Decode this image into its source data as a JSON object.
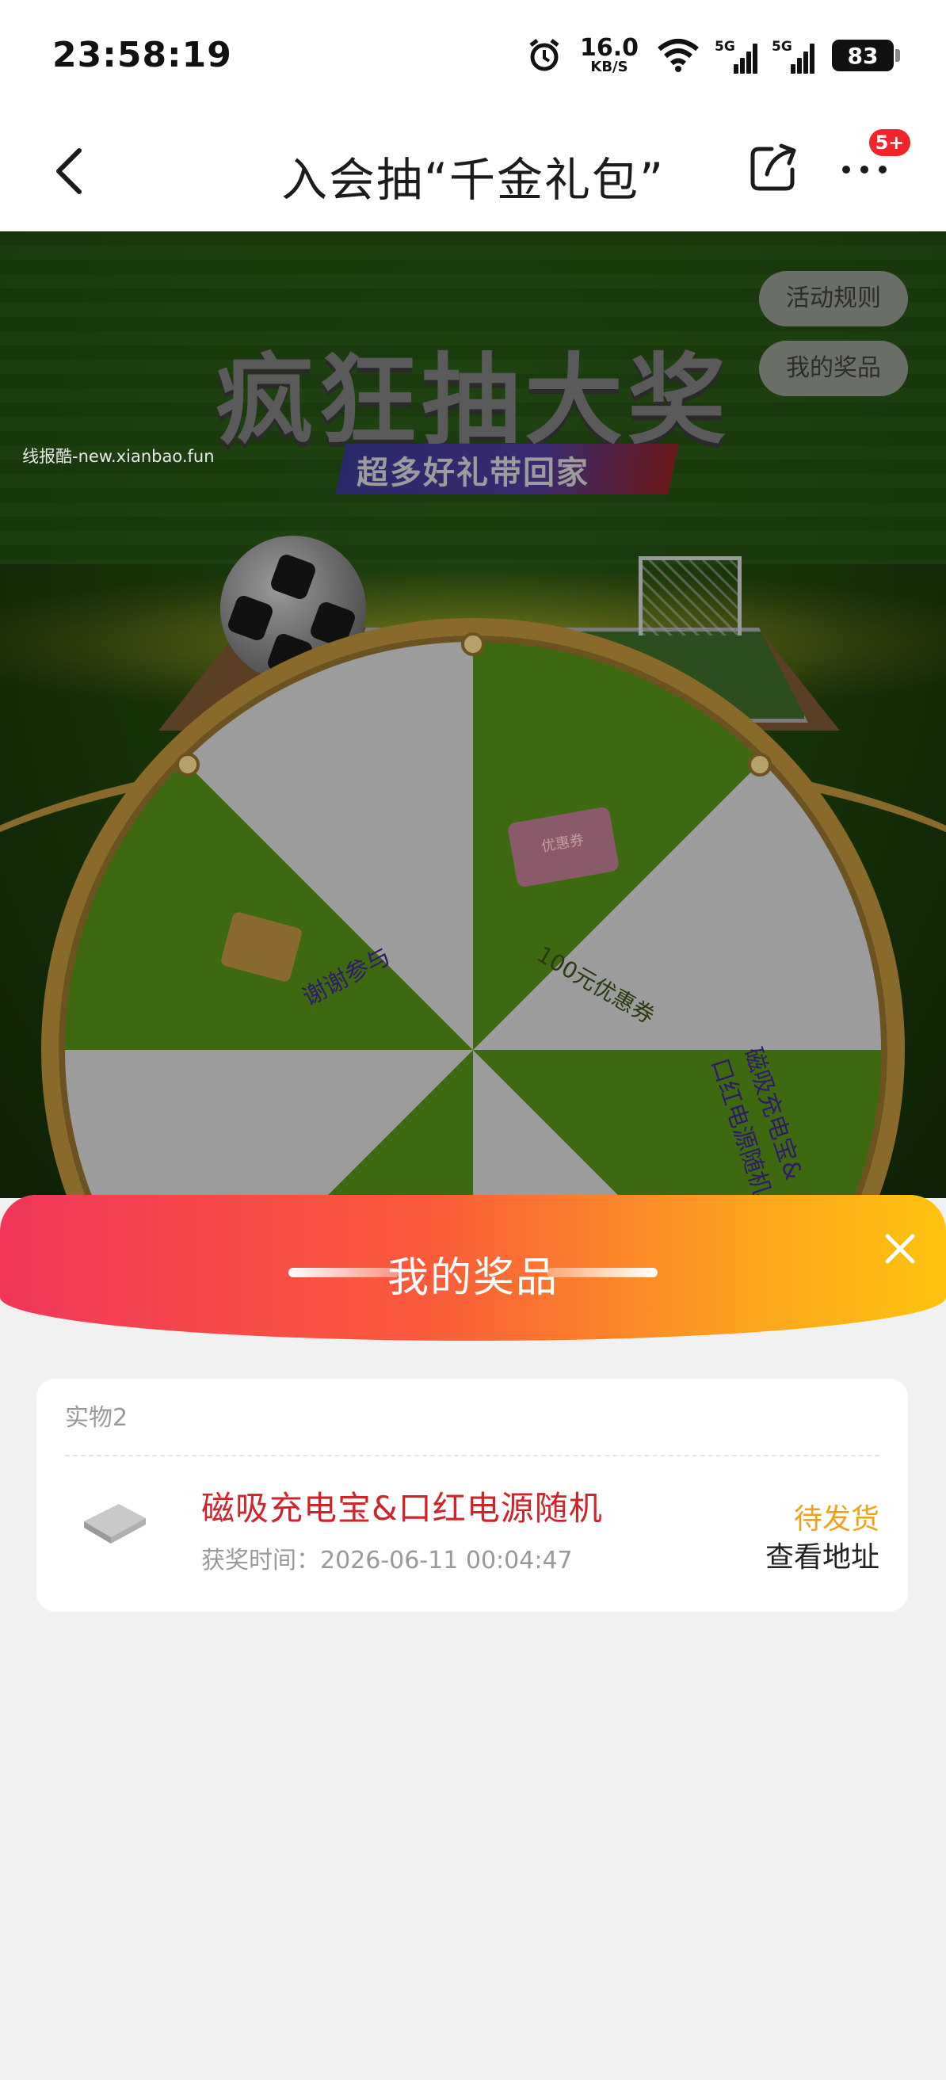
{
  "status_bar": {
    "time": "23:58:19",
    "net_speed": "16.0",
    "net_speed_unit": "KB/S",
    "signal1_label": "5G",
    "signal2_label": "5G",
    "battery": "83"
  },
  "nav": {
    "title": "入会抽“千金礼包”",
    "badge": "5+"
  },
  "activity": {
    "headline": "疯狂抽大奖",
    "subheadline": "超多好礼带回家",
    "rules_button": "活动规则",
    "my_prizes_button": "我的奖品",
    "watermark": "线报酷-new.xianbao.fun",
    "wheel": {
      "segments": [
        "谢谢参与",
        "100元优惠券",
        "磁吸充电宝&口红电源随机"
      ],
      "coupon_label": "优惠券"
    }
  },
  "sheet": {
    "title": "我的奖品",
    "section_label": "实物2",
    "prize": {
      "name": "磁吸充电宝&口红电源随机",
      "time_label": "获奖时间：2026-06-11 00:04:47",
      "status": "待发货",
      "action": "查看地址"
    }
  },
  "colors": {
    "accent_red": "#d0242a",
    "status_orange": "#f0a21a",
    "header_gradient_start": "#f2365a",
    "header_gradient_end": "#ffc30f"
  }
}
